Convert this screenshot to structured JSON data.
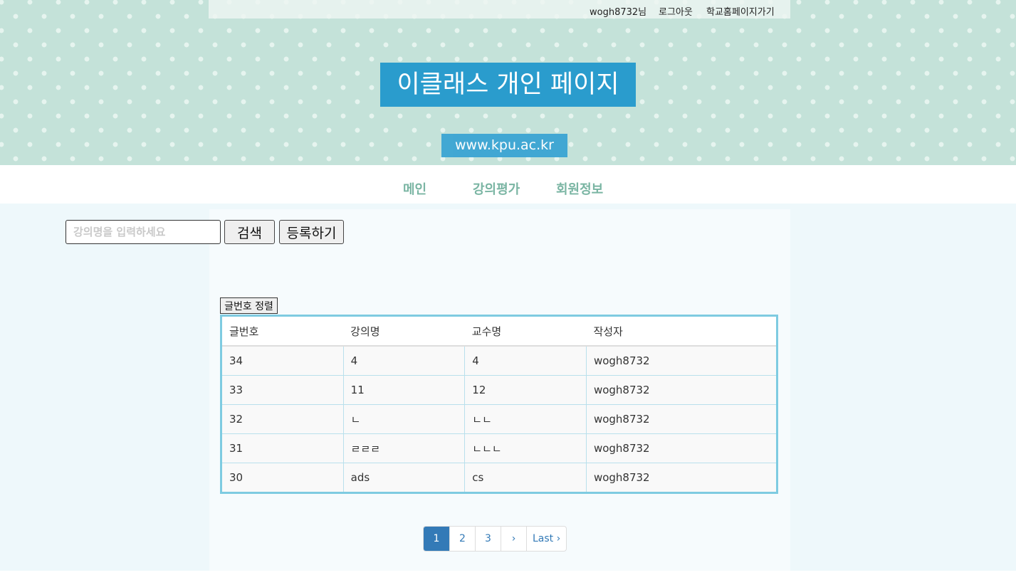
{
  "topbar": {
    "user": "wogh8732님",
    "logout": "로그아웃",
    "school_home": "학교홈페이지가기"
  },
  "header": {
    "title": "이클래스 개인 페이지",
    "url": "www.kpu.ac.kr"
  },
  "nav": {
    "items": [
      "메인",
      "강의평가",
      "회원정보"
    ]
  },
  "search": {
    "placeholder": "강의명을 입력하세요",
    "value": "",
    "search_button": "검색",
    "register_button": "등록하기"
  },
  "sort_button": "글번호 정렬",
  "table": {
    "headers": [
      "글번호",
      "강의명",
      "교수명",
      "작성자"
    ],
    "rows": [
      [
        "34",
        "4",
        "4",
        "wogh8732"
      ],
      [
        "33",
        "11",
        "12",
        "wogh8732"
      ],
      [
        "32",
        "ㄴ",
        "ㄴㄴ",
        "wogh8732"
      ],
      [
        "31",
        "ㄹㄹㄹ",
        "ㄴㄴㄴ",
        "wogh8732"
      ],
      [
        "30",
        "ads",
        "cs",
        "wogh8732"
      ]
    ]
  },
  "pagination": {
    "pages": [
      "1",
      "2",
      "3"
    ],
    "active": "1",
    "next": "›",
    "last": "Last ›"
  },
  "colors": {
    "header_bg": "#c4e2d9",
    "title_bg": "#2a9ccd",
    "nav_text": "#7ab5a3",
    "table_border": "#7ecbe1",
    "pager_active": "#337ab7"
  }
}
